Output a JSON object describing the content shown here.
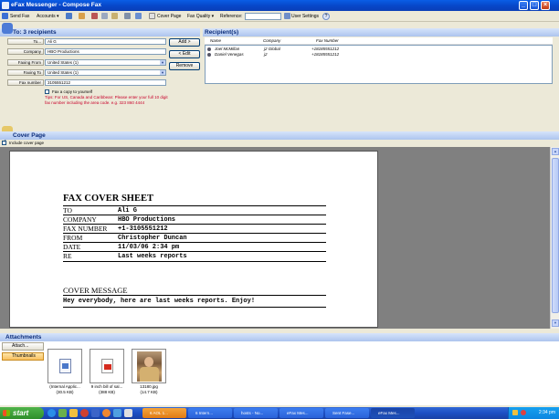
{
  "window": {
    "title": "eFax Messenger - Compose Fax",
    "min": "_",
    "max": "□",
    "close": "×"
  },
  "toolbar": {
    "send_fax": "Send Fax",
    "accounts": "Accounts ▾",
    "cover_page": "Cover Page",
    "fax_quality": "Fax Quality ▾",
    "reference": "Reference:",
    "user_settings": "User Settings",
    "help": "?"
  },
  "recipients_header": "To: 3 recipients",
  "form": {
    "to_label": "To...",
    "to_value": "Ali G",
    "company_label": "Company",
    "company_value": "HBO Productions",
    "faxing_from_label": "Faxing From",
    "faxing_from_value": "United States (1)",
    "faxing_to_label": "Faxing To",
    "faxing_to_value": "United States (1)",
    "fax_number_label": "Fax number",
    "fax_number_value": "3105551212",
    "copy_label": "Fax a copy to yourself",
    "tips": "Tips: For US, Canada and Caribbean: Please enter your full 10 digit fax number including the area code. e.g. 323 860 4444",
    "add_button": "Add >",
    "edit_button": "< Edit",
    "remove_button": "Remove"
  },
  "recipients_panel": {
    "title": "Recipient(s)",
    "columns": [
      "Name",
      "Company",
      "Fax Number"
    ],
    "rows": [
      {
        "name": "Joel McMillan",
        "company": "j2 Global",
        "fax": "+18185551212"
      },
      {
        "name": "Daniel Venegas",
        "company": "j2",
        "fax": "+18185551212"
      }
    ]
  },
  "cover_page": {
    "section_title": "Cover Page",
    "include_label": "Include cover page",
    "sheet_title": "FAX COVER SHEET",
    "fields": [
      {
        "label": "TO",
        "value": "Ali G"
      },
      {
        "label": "COMPANY",
        "value": "HBO Productions"
      },
      {
        "label": "FAX NUMBER",
        "value": "+1-3105551212"
      },
      {
        "label": "FROM",
        "value": "Christopher Duncan"
      },
      {
        "label": "DATE",
        "value": "11/03/06 2:34 pm"
      },
      {
        "label": "RE",
        "value": "Last weeks reports"
      }
    ],
    "message_title": "COVER MESSAGE",
    "message": "Hey everybody, here are last weeks reports. Enjoy!"
  },
  "attachments": {
    "section_title": "Attachments",
    "attach_button": "Attach...",
    "thumbnails_tab": "Thumbnails",
    "items": [
      {
        "name": "(Internal Applic...",
        "size": "(30.5 KB)",
        "icon": "document-icon"
      },
      {
        "name": "9 inch bill of sal...",
        "size": "(388 KB)",
        "icon": "pdf-icon"
      },
      {
        "name": "13180.jpg",
        "size": "(14.7 KB)",
        "icon": "photo-icon"
      }
    ]
  },
  "taskbar": {
    "start": "start",
    "tasks": [
      "6 AOL 1...",
      "6 Intern...",
      "hosts - No...",
      "eFax Mes...",
      "Sent Fase...",
      "eFax Mes..."
    ],
    "clock": "2:34 pm"
  }
}
